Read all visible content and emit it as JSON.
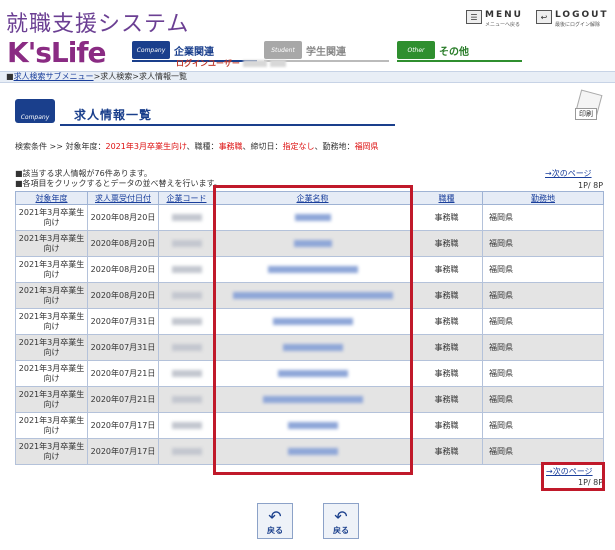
{
  "header": {
    "system_title": "就職支援システム",
    "logo": "K'sLife",
    "nav": [
      {
        "label": "企業関連",
        "icon_text": "Company",
        "icon": "building-icon",
        "color": "#1a3f8c"
      },
      {
        "label": "学生関連",
        "icon_text": "Student",
        "icon": "graduation-cap-icon",
        "color": "#999999"
      },
      {
        "label": "その他",
        "icon_text": "Other",
        "icon": "star-icon",
        "color": "#2f8f2f"
      }
    ],
    "login_user_label": "ログインユーザー",
    "menu": {
      "main": "MENU",
      "sub": "メニューへ戻る"
    },
    "logout": {
      "main": "LOGOUT",
      "sub": "最後にログイン解除"
    }
  },
  "breadcrumb": {
    "link": "求人検索サブメニュー",
    "rest": ">求人検索>求人情報一覧"
  },
  "page": {
    "title": "求人情報一覧",
    "icon_text": "Company",
    "print_label": "印刷"
  },
  "conditions": {
    "prefix": "検索条件 >> ",
    "year_label": "対象年度：",
    "year_value": "2021年3月卒業生向け",
    "job_label": "、職種：",
    "job_value": "事務職",
    "deadline_label": "、締切日：",
    "deadline_value": "指定なし",
    "location_label": "、勤務地：",
    "location_value": "福岡県"
  },
  "notes": {
    "line1": "■該当する求人情報が76件あります。",
    "line2": "■各項目をクリックするとデータの並べ替えを行います。"
  },
  "pagination": {
    "next_label": "→次のページ",
    "page_info": "1P/ 8P"
  },
  "table": {
    "headers": [
      "対象年度",
      "求人票受付日付",
      "企業コード",
      "企業名称",
      "職種",
      "勤務地"
    ],
    "rows": [
      {
        "year": "2021年3月卒業生向け",
        "date": "2020年08月20日",
        "job": "事務職",
        "location": "福岡県"
      },
      {
        "year": "2021年3月卒業生向け",
        "date": "2020年08月20日",
        "job": "事務職",
        "location": "福岡県"
      },
      {
        "year": "2021年3月卒業生向け",
        "date": "2020年08月20日",
        "job": "事務職",
        "location": "福岡県"
      },
      {
        "year": "2021年3月卒業生向け",
        "date": "2020年08月20日",
        "job": "事務職",
        "location": "福岡県"
      },
      {
        "year": "2021年3月卒業生向け",
        "date": "2020年07月31日",
        "job": "事務職",
        "location": "福岡県"
      },
      {
        "year": "2021年3月卒業生向け",
        "date": "2020年07月31日",
        "job": "事務職",
        "location": "福岡県"
      },
      {
        "year": "2021年3月卒業生向け",
        "date": "2020年07月21日",
        "job": "事務職",
        "location": "福岡県"
      },
      {
        "year": "2021年3月卒業生向け",
        "date": "2020年07月21日",
        "job": "事務職",
        "location": "福岡県"
      },
      {
        "year": "2021年3月卒業生向け",
        "date": "2020年07月17日",
        "job": "事務職",
        "location": "福岡県"
      },
      {
        "year": "2021年3月卒業生向け",
        "date": "2020年07月17日",
        "job": "事務職",
        "location": "福岡県"
      }
    ]
  },
  "back_buttons": [
    {
      "label": "戻る",
      "icon": "back-arrow-icon"
    },
    {
      "label": "戻る",
      "icon": "company-back-icon"
    }
  ],
  "colors": {
    "brand_purple": "#8a2b83",
    "company_blue": "#1a3f8c",
    "highlight_red": "#c0192a",
    "condition_red": "#d11111"
  }
}
